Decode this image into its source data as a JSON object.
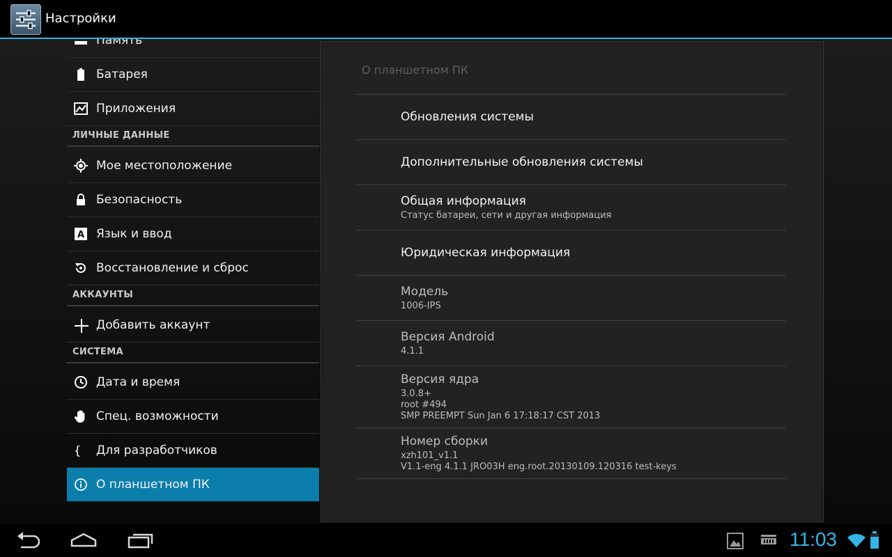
{
  "app": {
    "title": "Настройки"
  },
  "sidebar": {
    "items_top": [
      {
        "label": "Память",
        "icon": "storage-icon"
      },
      {
        "label": "Батарея",
        "icon": "battery-icon"
      },
      {
        "label": "Приложения",
        "icon": "apps-icon"
      }
    ],
    "section_personal": "ЛИЧНЫЕ ДАННЫЕ",
    "items_personal": [
      {
        "label": "Мое местоположение",
        "icon": "location-icon"
      },
      {
        "label": "Безопасность",
        "icon": "lock-icon"
      },
      {
        "label": "Язык и ввод",
        "icon": "language-icon"
      },
      {
        "label": "Восстановление и сброс",
        "icon": "restore-icon"
      }
    ],
    "section_accounts": "АККАУНТЫ",
    "items_accounts": [
      {
        "label": "Добавить аккаунт",
        "icon": "plus-icon"
      }
    ],
    "section_system": "СИСТЕМА",
    "items_system": [
      {
        "label": "Дата и время",
        "icon": "clock-icon"
      },
      {
        "label": "Спец. возможности",
        "icon": "hand-icon"
      },
      {
        "label": "Для разработчиков",
        "icon": "braces-icon"
      },
      {
        "label": "О планшетном ПК",
        "icon": "info-icon",
        "active": true
      }
    ]
  },
  "panel": {
    "title": "О планшетном ПК",
    "prefs": [
      {
        "title": "Обновления системы"
      },
      {
        "title": "Дополнительные обновления системы"
      },
      {
        "title": "Общая информация",
        "summary": "Статус батареи, сети и другая информация"
      },
      {
        "title": "Юридическая информация"
      },
      {
        "title": "Модель",
        "summary": "1006-IPS"
      },
      {
        "title": "Версия Android",
        "summary": "4.1.1"
      },
      {
        "title": "Версия ядра",
        "summary_lines": [
          "3.0.8+",
          "root #494",
          "SMP PREEMPT Sun Jan 6 17:18:17 CST 2013"
        ]
      },
      {
        "title": "Номер сборки",
        "summary_lines": [
          "xzh101_v1.1",
          "V1.1-eng 4.1.1 JRO03H eng.root.20130109.120316 test-keys"
        ]
      }
    ]
  },
  "statusbar": {
    "time": "11:03",
    "accent_color": "#33b5e5",
    "icons": [
      "gallery-icon",
      "usb-debug-icon",
      "wifi-icon",
      "battery-status-icon"
    ]
  },
  "colors": {
    "accent": "#33b5e5",
    "selected_item": "#0b7eab"
  }
}
